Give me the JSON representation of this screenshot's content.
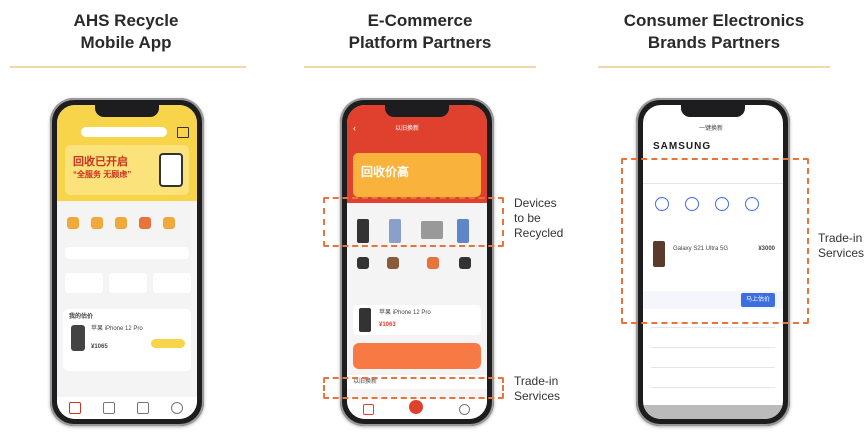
{
  "columns": [
    {
      "title_line1": "AHS Recycle",
      "title_line2": "Mobile App"
    },
    {
      "title_line1": "E-Commerce",
      "title_line2": "Platform Partners"
    },
    {
      "title_line1": "Consumer Electronics",
      "title_line2": "Brands Partners"
    }
  ],
  "callouts": {
    "devices": [
      "Devices",
      "to be",
      "Recycled"
    ],
    "trade_in_ecommerce": [
      "Trade-in",
      "Services"
    ],
    "trade_in_brand": [
      "Trade-in",
      "Services"
    ]
  },
  "phone1": {
    "banner": "回收已开启",
    "banner_sub": "“全服务 无顾虑”",
    "device_name": "苹果 iPhone 12 Pro",
    "price": "¥1065",
    "section": "我的估价"
  },
  "phone2": {
    "header": "以旧换新",
    "banner": "回收价高",
    "device_name": "苹果 iPhone 12 Pro",
    "price": "¥1063",
    "trade_in_label": "以旧换新"
  },
  "phone3": {
    "brand": "SAMSUNG",
    "header": "一键换新",
    "device_name": "Galaxy S21 Ultra 5G",
    "price": "¥3000",
    "button": "马上估价"
  },
  "colors": {
    "accent": "#e8743b",
    "brand_red": "#e0412f",
    "yellow": "#f7d44a",
    "rule": "#f2d7a8",
    "blue": "#3d6ee0"
  }
}
